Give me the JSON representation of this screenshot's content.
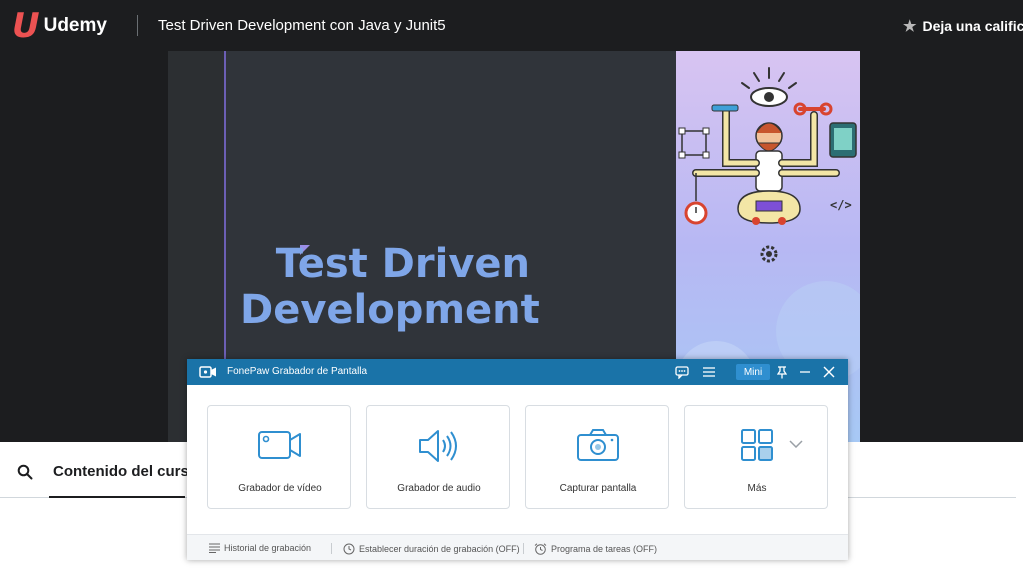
{
  "header": {
    "logo_text": "Udemy",
    "course_title": "Test Driven Development con Java y Junit5",
    "rate_label": "Deja una calificac"
  },
  "video": {
    "slide_title_line1": "Test Driven",
    "slide_title_line2": "Development"
  },
  "course_content": {
    "tab_label": "Contenido del curso"
  },
  "fonepaw": {
    "title": "FonePaw Grabador de Pantalla",
    "mini_label": "Mini",
    "cards": [
      {
        "label": "Grabador de vídeo",
        "icon": "video-camera-icon"
      },
      {
        "label": "Grabador de audio",
        "icon": "speaker-icon"
      },
      {
        "label": "Capturar pantalla",
        "icon": "camera-icon"
      },
      {
        "label": "Más",
        "icon": "grid-icon"
      }
    ],
    "status": {
      "history": "Historial de grabación",
      "duration": "Establecer duración de grabación (OFF)",
      "schedule": "Programa de tareas (OFF)"
    }
  },
  "colors": {
    "udemy_red": "#ec5252",
    "header_bg": "#1c1d1f",
    "fonepaw_blue": "#1a73a8",
    "icon_blue": "#2f8fd0",
    "slide_title": "#7fa6e8"
  }
}
